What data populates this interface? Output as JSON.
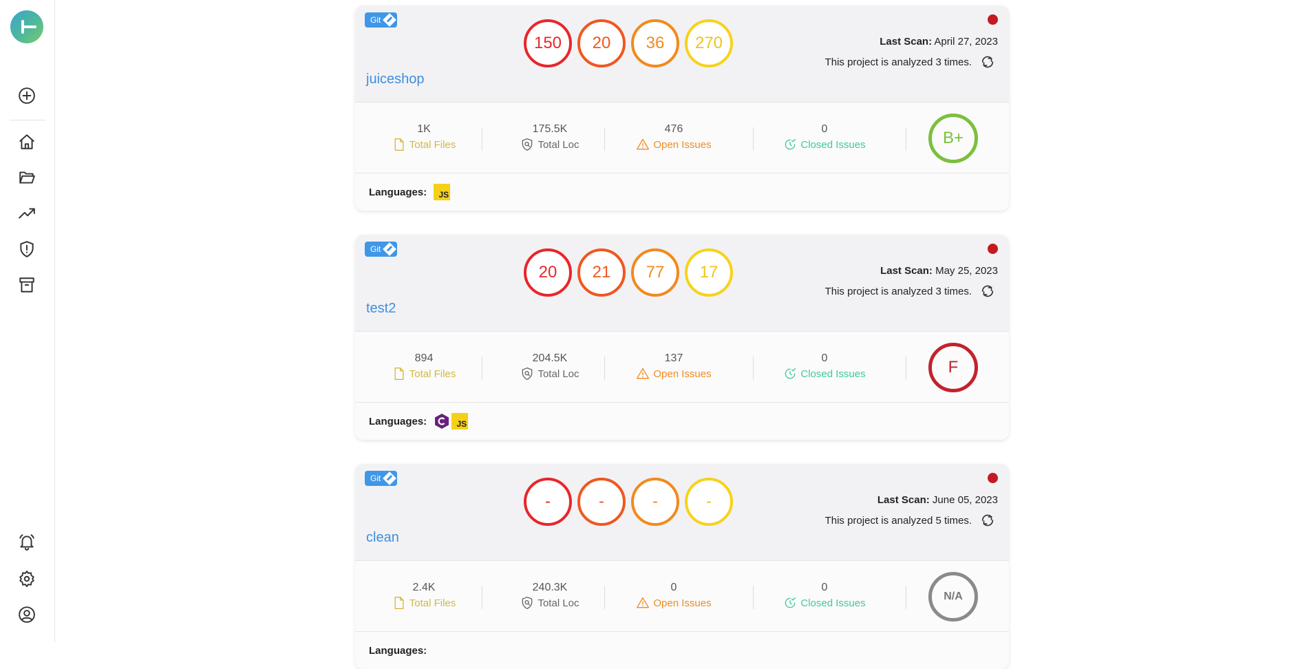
{
  "sidebar": {
    "logo": "app-logo",
    "items": [
      {
        "name": "add-project",
        "icon": "plus-circle-icon"
      },
      {
        "name": "home",
        "icon": "home-icon"
      },
      {
        "name": "projects",
        "icon": "folder-icon"
      },
      {
        "name": "trends",
        "icon": "trending-up-icon"
      },
      {
        "name": "security",
        "icon": "shield-alert-icon"
      },
      {
        "name": "archive",
        "icon": "archive-icon"
      },
      {
        "name": "notifications",
        "icon": "bell-icon"
      },
      {
        "name": "settings",
        "icon": "gear-icon"
      },
      {
        "name": "profile",
        "icon": "user-circle-icon"
      }
    ]
  },
  "labels": {
    "git": "Git",
    "last_scan": "Last Scan:",
    "total_files": "Total Files",
    "total_loc": "Total Loc",
    "open_issues": "Open Issues",
    "closed_issues": "Closed Issues",
    "languages": "Languages:"
  },
  "projects": [
    {
      "name": "juiceshop",
      "severity": {
        "critical": "150",
        "high": "20",
        "medium": "36",
        "low": "270"
      },
      "last_scan_date": "April 27, 2023",
      "analyzed_text": "This project is analyzed 3 times.",
      "total_files": "1K",
      "total_loc": "175.5K",
      "open_issues": "476",
      "closed_issues": "0",
      "grade": "B+",
      "languages": [
        "JS"
      ]
    },
    {
      "name": "test2",
      "severity": {
        "critical": "20",
        "high": "21",
        "medium": "77",
        "low": "17"
      },
      "last_scan_date": "May 25, 2023",
      "analyzed_text": "This project is analyzed 3 times.",
      "total_files": "894",
      "total_loc": "204.5K",
      "open_issues": "137",
      "closed_issues": "0",
      "grade": "F",
      "languages": [
        "C#",
        "JS"
      ]
    },
    {
      "name": "clean",
      "severity": {
        "critical": "-",
        "high": "-",
        "medium": "-",
        "low": "-"
      },
      "last_scan_date": "June 05, 2023",
      "analyzed_text": "This project is analyzed 5 times.",
      "total_files": "2.4K",
      "total_loc": "240.3K",
      "open_issues": "0",
      "closed_issues": "0",
      "grade": "N/A",
      "languages": []
    }
  ],
  "colors": {
    "critical": "#e8262a",
    "high": "#f0571f",
    "medium": "#f28a1e",
    "low": "#f7d21b",
    "link": "#3f8ee0",
    "git_badge": "#3f97e8",
    "status_dot": "#c41a22",
    "total_files": "#d4b640",
    "open_issues": "#f28a1e",
    "closed_issues": "#3ec99a"
  }
}
